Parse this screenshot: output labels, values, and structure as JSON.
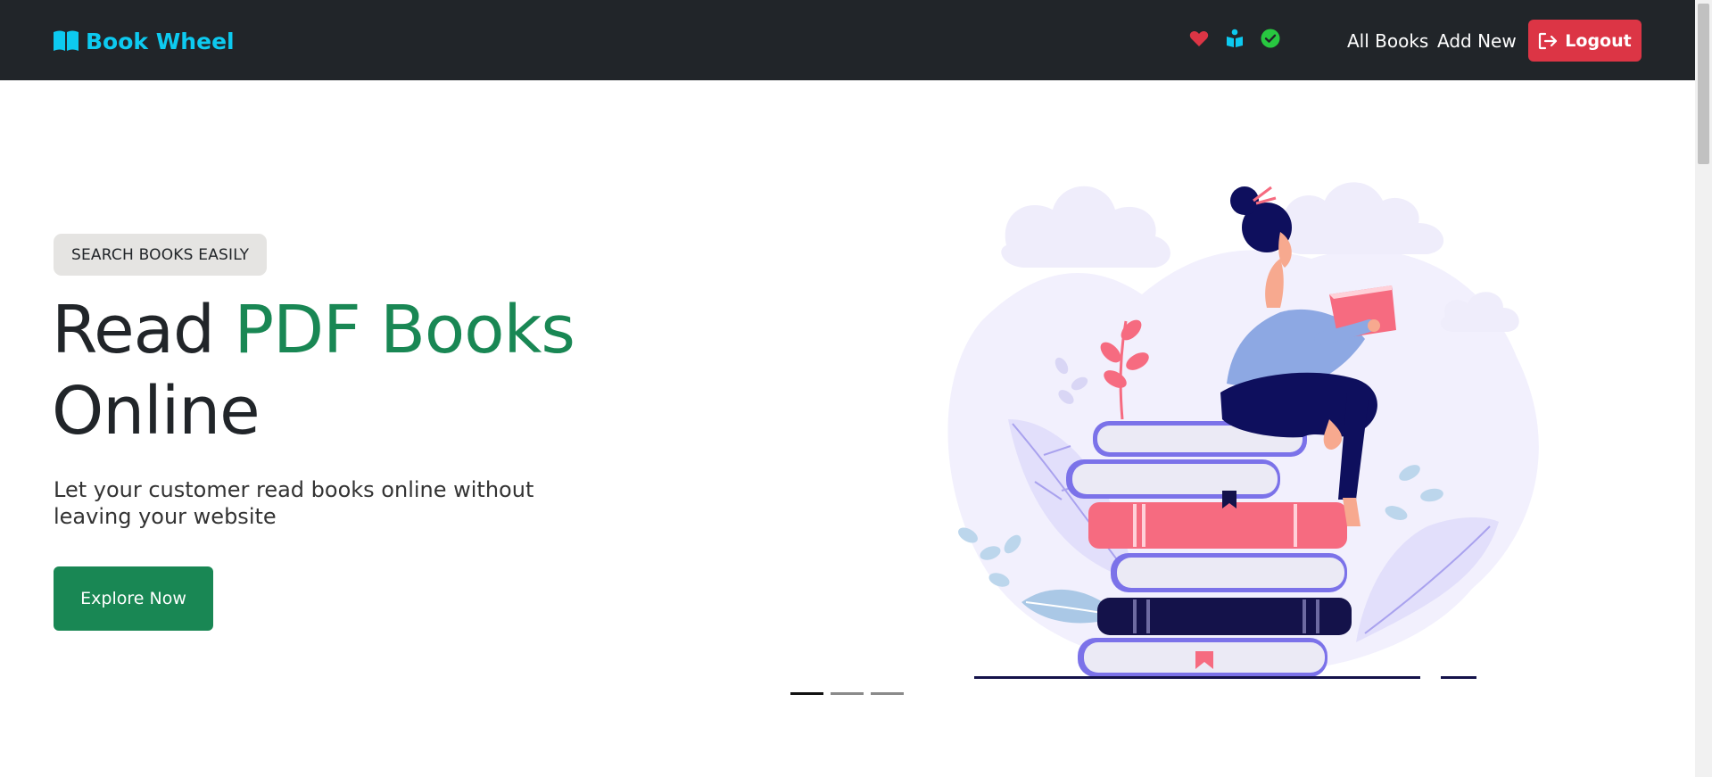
{
  "navbar": {
    "brand": "Book Wheel",
    "links": [
      "All Books",
      "Add New"
    ],
    "logout_label": "Logout",
    "status_icons": [
      "heart-icon",
      "reader-icon",
      "check-circle-icon"
    ]
  },
  "hero": {
    "badge": "SEARCH BOOKS EASILY",
    "title_prefix": "Read ",
    "title_accent": "PDF Books",
    "title_suffix": "Online",
    "subtitle": "Let your customer read books online without leaving your website",
    "cta_label": "Explore Now",
    "carousel_slides": 3,
    "active_slide": 1
  },
  "colors": {
    "navbar_bg": "#212529",
    "brand": "#0dcaf0",
    "accent_green": "#198754",
    "logout_red": "#dc3545",
    "heart_red": "#dc3545",
    "check_green": "#28c840",
    "book_pink": "#f66b80",
    "book_navy": "#14124a",
    "book_purple": "#7b72e9"
  }
}
